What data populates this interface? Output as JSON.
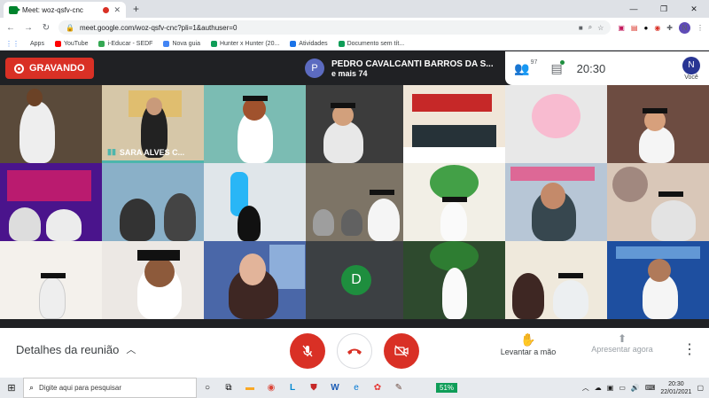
{
  "browser": {
    "tab_title": "Meet: woz-qsfv-cnc",
    "url": "meet.google.com/woz-qsfv-cnc?pli=1&authuser=0",
    "profile_initial": "N",
    "bookmarks": [
      {
        "label": "Apps",
        "color": "#4285f4"
      },
      {
        "label": "YouTube",
        "color": "#ff0000"
      },
      {
        "label": "i-Educar - SEDF",
        "color": "#34a853"
      },
      {
        "label": "Nova guia",
        "color": "#4285f4"
      },
      {
        "label": "Hunter x Hunter (20...",
        "color": "#0f9d58"
      },
      {
        "label": "Atividades",
        "color": "#1a73e8"
      },
      {
        "label": "Documento sem tít...",
        "color": "#0f9d58"
      }
    ]
  },
  "meet": {
    "recording_label": "GRAVANDO",
    "presenter_initial": "P",
    "presenter_name": "PEDRO CAVALCANTI BARROS DA S...",
    "presenter_more": "e mais 74",
    "participants_count": "97",
    "time": "20:30",
    "you_initial": "N",
    "you_label": "Você",
    "tile_label_sara": "SARA ALVES C...",
    "tile_d_initial": "D"
  },
  "controls": {
    "details_label": "Detalhes da reunião",
    "raise_hand_label": "Levantar a mão",
    "present_label": "Apresentar agora"
  },
  "taskbar": {
    "search_placeholder": "Digite aqui para pesquisar",
    "battery": "51%",
    "clock_time": "20:30",
    "clock_date": "22/01/2021"
  }
}
